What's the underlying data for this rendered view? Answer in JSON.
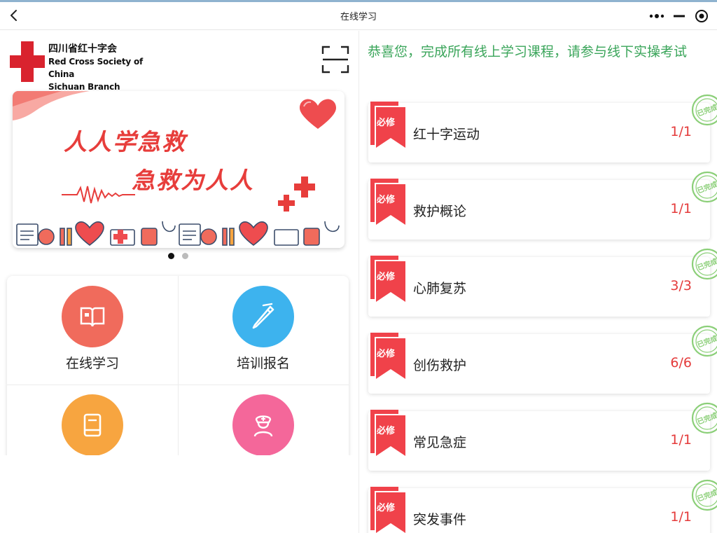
{
  "nav": {
    "title": "在线学习",
    "back_icon": "chevron-left-icon",
    "more_icon": "more-dots-icon",
    "minimize_icon": "minus-icon",
    "close_icon": "target-close-icon"
  },
  "logo": {
    "name_cn": "四川省红十字会",
    "name_en_line1": "Red Cross Society of China",
    "name_en_line2": "Sichuan Branch",
    "icon": "red-cross-icon",
    "color": "#d9232e"
  },
  "scan_icon": "scan-icon",
  "banner": {
    "line1": "人人学急救",
    "line2": "急救为人人",
    "slides": 2,
    "active_slide": 1
  },
  "menu": [
    {
      "label": "在线学习",
      "icon": "book-open-icon",
      "color": "#f06b5c"
    },
    {
      "label": "培训报名",
      "icon": "pen-icon",
      "color": "#3db3ee"
    },
    {
      "label": "",
      "icon": "book-icon",
      "color": "#f7a540"
    },
    {
      "label": "",
      "icon": "nurse-icon",
      "color": "#f4679a"
    }
  ],
  "congrats": "恭喜您，完成所有线上学习课程，请参与线下实操考试",
  "required_tag": "必修",
  "completed_stamp": "已完成",
  "courses": [
    {
      "name": "红十字运动",
      "progress": "1/1"
    },
    {
      "name": "救护概论",
      "progress": "1/1"
    },
    {
      "name": "心肺复苏",
      "progress": "3/3"
    },
    {
      "name": "创伤救护",
      "progress": "6/6"
    },
    {
      "name": "常见急症",
      "progress": "1/1"
    },
    {
      "name": "突发事件",
      "progress": "1/1"
    }
  ],
  "colors": {
    "accent_red": "#e43b3b",
    "success_green": "#3aa55a",
    "ribbon_red": "#f0424a"
  }
}
